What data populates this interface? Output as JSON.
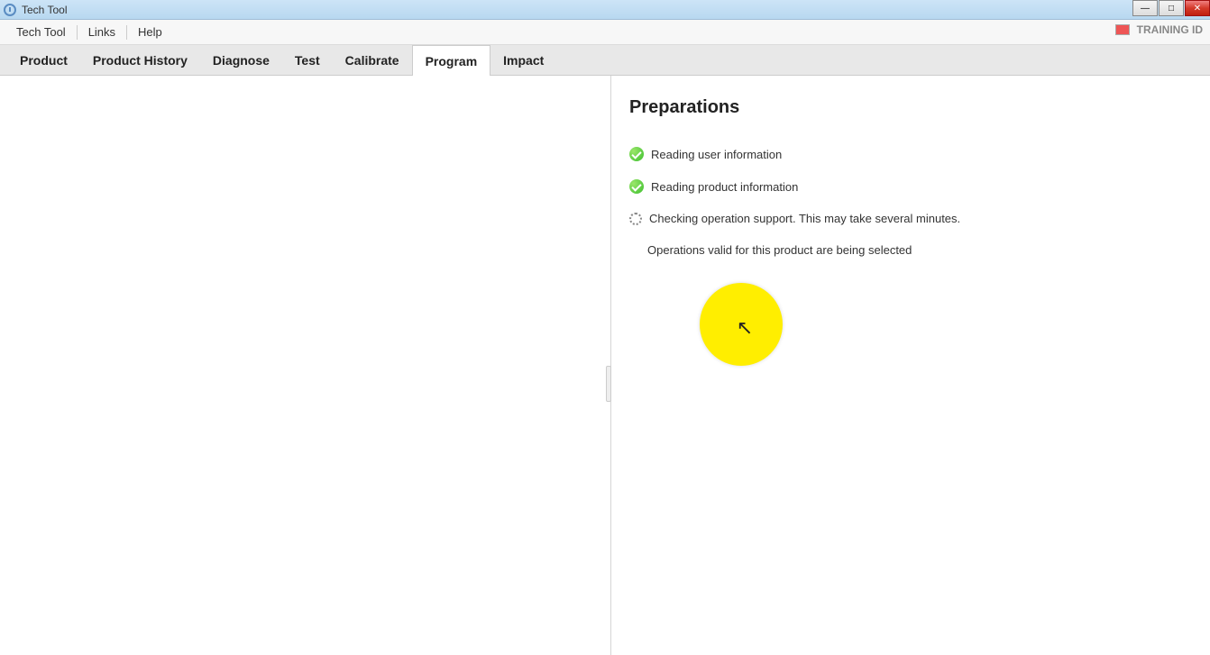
{
  "window": {
    "title": "Tech Tool"
  },
  "menu": {
    "items": [
      "Tech Tool",
      "Links",
      "Help"
    ]
  },
  "status": {
    "label": "TRAINING ID"
  },
  "tabs": {
    "items": [
      "Product",
      "Product History",
      "Diagnose",
      "Test",
      "Calibrate",
      "Program",
      "Impact"
    ],
    "active_index": 5
  },
  "preparations": {
    "title": "Preparations",
    "steps": [
      {
        "state": "done",
        "label": "Reading user information"
      },
      {
        "state": "done",
        "label": "Reading product information"
      },
      {
        "state": "busy",
        "label": "Checking operation support. This may take several minutes."
      }
    ],
    "sub_text": "Operations valid for this product are being selected"
  }
}
